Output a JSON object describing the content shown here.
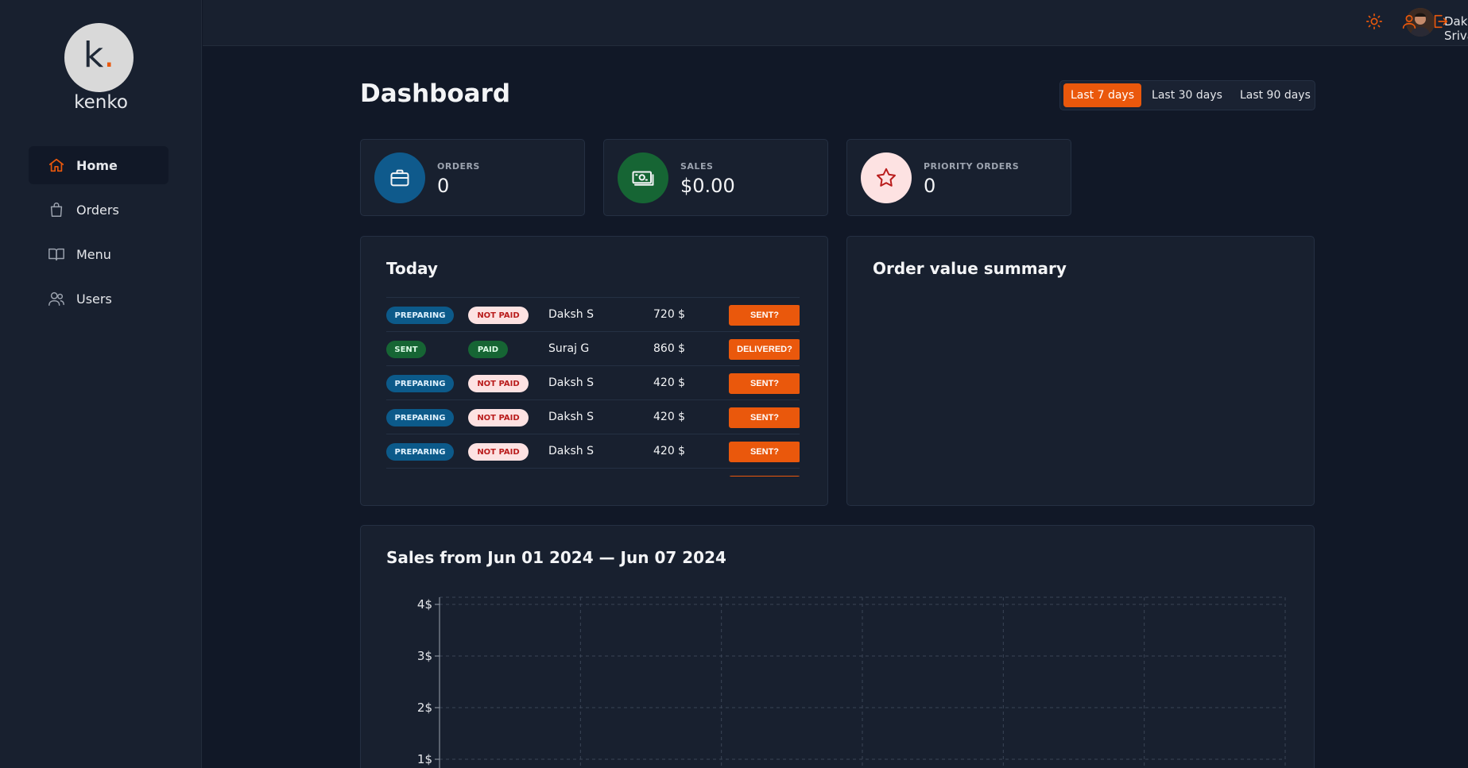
{
  "brand": {
    "logo_letter": "k",
    "name": "kenko"
  },
  "sidebar": {
    "items": [
      {
        "label": "Home",
        "icon": "home-icon",
        "active": true
      },
      {
        "label": "Orders",
        "icon": "shopping-bag-icon",
        "active": false
      },
      {
        "label": "Menu",
        "icon": "book-open-icon",
        "active": false
      },
      {
        "label": "Users",
        "icon": "users-icon",
        "active": false
      }
    ]
  },
  "topbar": {
    "user_name": "Daksh Srivastava",
    "icons": [
      "sun-icon",
      "user-icon",
      "logout-icon"
    ],
    "accent": "#ea580c"
  },
  "page": {
    "title": "Dashboard",
    "ranges": [
      {
        "label": "Last 7 days",
        "active": true
      },
      {
        "label": "Last 30 days",
        "active": false
      },
      {
        "label": "Last 90 days",
        "active": false
      }
    ]
  },
  "stats": [
    {
      "label": "ORDERS",
      "value": "0",
      "icon": "briefcase-icon",
      "color": "#0f5a8c"
    },
    {
      "label": "SALES",
      "value": "$0.00",
      "icon": "banknote-icon",
      "color": "#166534"
    },
    {
      "label": "PRIORITY ORDERS",
      "value": "0",
      "icon": "star-icon",
      "color": "#fde2e2"
    }
  ],
  "today": {
    "title": "Today",
    "orders": [
      {
        "status": "PREPARING",
        "payment": "NOT PAID",
        "customer": "Daksh S",
        "amount": "720 $",
        "action": "SENT?"
      },
      {
        "status": "SENT",
        "payment": "PAID",
        "customer": "Suraj G",
        "amount": "860 $",
        "action": "DELIVERED?"
      },
      {
        "status": "PREPARING",
        "payment": "NOT PAID",
        "customer": "Daksh S",
        "amount": "420 $",
        "action": "SENT?"
      },
      {
        "status": "PREPARING",
        "payment": "NOT PAID",
        "customer": "Daksh S",
        "amount": "420 $",
        "action": "SENT?"
      },
      {
        "status": "PREPARING",
        "payment": "NOT PAID",
        "customer": "Daksh S",
        "amount": "420 $",
        "action": "SENT?"
      }
    ]
  },
  "summary": {
    "title": "Order value summary"
  },
  "sales_chart": {
    "title": "Sales from Jun 01 2024 — Jun 07 2024"
  },
  "chart_data": {
    "type": "area",
    "title": "Sales from Jun 01 2024 — Jun 07 2024",
    "xlabel": "",
    "ylabel": "",
    "y_ticks": [
      "4$",
      "3$",
      "2$",
      "1$"
    ],
    "y_tick_values": [
      4,
      3,
      2,
      1
    ],
    "ylim": [
      0,
      4
    ],
    "grid": true,
    "series": []
  }
}
